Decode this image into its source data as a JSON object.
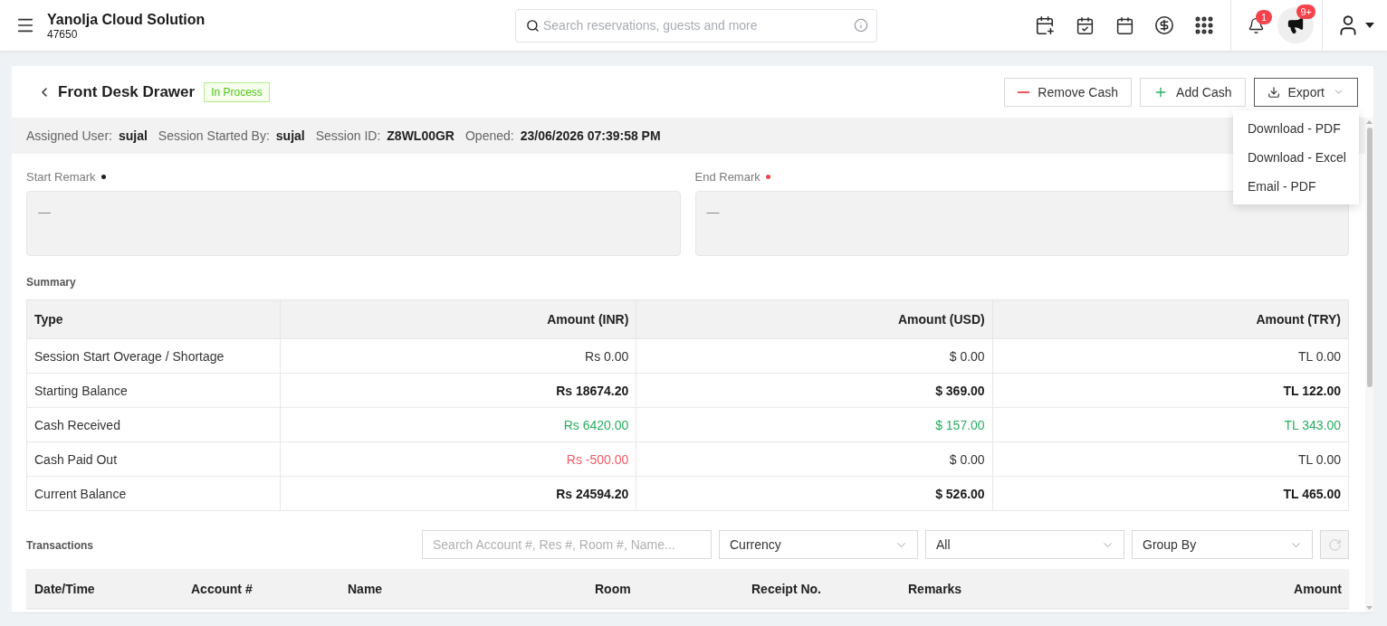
{
  "top_bar": {
    "brand": "Yanolja Cloud Solution",
    "property_id": "47650",
    "search": {
      "placeholder": "Search reservations, guests and more"
    },
    "notification_count": "1",
    "announcement_count": "9+"
  },
  "header": {
    "title": "Front Desk Drawer",
    "status": "In Process",
    "actions": [
      {
        "label": "Remove Cash",
        "kind": "remove",
        "expanded": false
      },
      {
        "label": "Add Cash",
        "kind": "add",
        "expanded": false
      },
      {
        "label": "Export",
        "kind": "export",
        "expanded": true
      }
    ],
    "export_menu": [
      "Download - PDF",
      "Download - Excel",
      "Email - PDF"
    ]
  },
  "session_info": [
    {
      "label": "Assigned User:",
      "value": "sujal"
    },
    {
      "label": "Session Started By:",
      "value": "sujal"
    },
    {
      "label": "Session ID:",
      "value": "Z8WL00GR"
    },
    {
      "label": "Opened:",
      "value": "23/06/2026 07:39:58 PM"
    }
  ],
  "remarks": [
    {
      "label": "Start Remark",
      "color": "#1f1f1f",
      "placeholder": "—"
    },
    {
      "label": "End Remark",
      "color": "#f5454f",
      "placeholder": "—"
    }
  ],
  "summary": {
    "title": "Summary",
    "columns": [
      "Type",
      "Amount (INR)",
      "Amount (USD)",
      "Amount (TRY)"
    ],
    "rows": [
      {
        "cells": [
          {
            "text": "Session Start Overage / Shortage",
            "kind": "label"
          },
          {
            "text": "Rs 0.00",
            "kind": "plain"
          },
          {
            "text": "$ 0.00",
            "kind": "plain"
          },
          {
            "text": "TL 0.00",
            "kind": "plain"
          }
        ]
      },
      {
        "cells": [
          {
            "text": "Starting Balance",
            "kind": "label"
          },
          {
            "text": "Rs 18674.20",
            "kind": "total"
          },
          {
            "text": "$ 369.00",
            "kind": "total"
          },
          {
            "text": "TL 122.00",
            "kind": "total"
          }
        ]
      },
      {
        "cells": [
          {
            "text": "Cash Received",
            "kind": "label"
          },
          {
            "text": "Rs 6420.00",
            "kind": "credit"
          },
          {
            "text": "$ 157.00",
            "kind": "credit"
          },
          {
            "text": "TL 343.00",
            "kind": "credit"
          }
        ]
      },
      {
        "cells": [
          {
            "text": "Cash Paid Out",
            "kind": "label"
          },
          {
            "text": "Rs -500.00",
            "kind": "debit"
          },
          {
            "text": "$ 0.00",
            "kind": "plain"
          },
          {
            "text": "TL 0.00",
            "kind": "plain"
          }
        ]
      },
      {
        "cells": [
          {
            "text": "Current Balance",
            "kind": "label"
          },
          {
            "text": "Rs 24594.20",
            "kind": "total"
          },
          {
            "text": "$ 526.00",
            "kind": "total"
          },
          {
            "text": "TL 465.00",
            "kind": "total"
          }
        ]
      }
    ]
  },
  "transactions": {
    "title": "Transactions",
    "search": {
      "placeholder": "Search Account #, Res #, Room #, Name..."
    },
    "filters": [
      "Currency",
      "All",
      "Group By"
    ],
    "refresh": {
      "disabled": true
    },
    "columns": [
      "Date/Time",
      "Account #",
      "Name",
      "Room",
      "Receipt No.",
      "Remarks",
      "Amount"
    ]
  }
}
